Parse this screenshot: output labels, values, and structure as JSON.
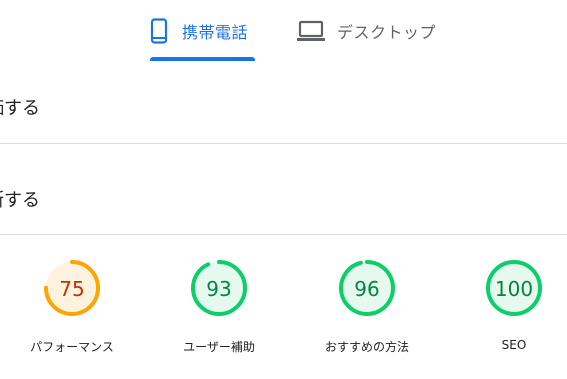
{
  "tabs": {
    "mobile": {
      "label": "携帯電話",
      "icon": "smartphone-icon",
      "color": "#1a73e8"
    },
    "desktop": {
      "label": "デスクトップ",
      "icon": "laptop-icon",
      "color": "#5f6368"
    }
  },
  "sections": [
    {
      "text": "価する"
    },
    {
      "text": "断する"
    }
  ],
  "scores": [
    {
      "label": "パフォーマンス",
      "value": "75",
      "score": 75,
      "color": "#ffa400",
      "fill": "#fff3e0",
      "text_color": "#c33300"
    },
    {
      "label": "ユーザー補助",
      "value": "93",
      "score": 93,
      "color": "#0cce6b",
      "fill": "#e6f9ef",
      "text_color": "#018642"
    },
    {
      "label": "おすすめの方法",
      "value": "96",
      "score": 96,
      "color": "#0cce6b",
      "fill": "#e6f9ef",
      "text_color": "#018642"
    },
    {
      "label": "SEO",
      "value": "100",
      "score": 100,
      "color": "#0cce6b",
      "fill": "#e6f9ef",
      "text_color": "#018642"
    }
  ]
}
